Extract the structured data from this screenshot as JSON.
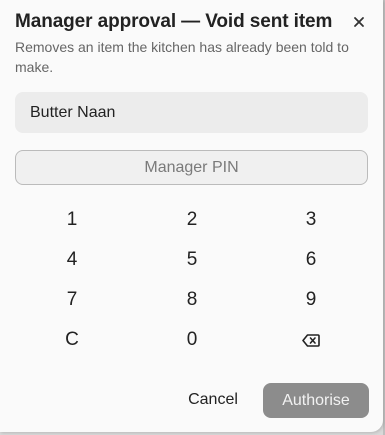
{
  "dialog": {
    "title": "Manager approval — Void sent item",
    "subtitle": "Removes an item the kitchen has already been told to make.",
    "item_value": "Butter Naan",
    "pin_placeholder": "Manager PIN",
    "keypad": [
      "1",
      "2",
      "3",
      "4",
      "5",
      "6",
      "7",
      "8",
      "9",
      "C",
      "0"
    ],
    "backspace_icon": "backspace-icon",
    "close_icon": "close-icon",
    "cancel_label": "Cancel",
    "authorise_label": "Authorise",
    "colors": {
      "authorise_bg": "#8c8c8c",
      "pin_border": "#bbbbbb"
    }
  }
}
